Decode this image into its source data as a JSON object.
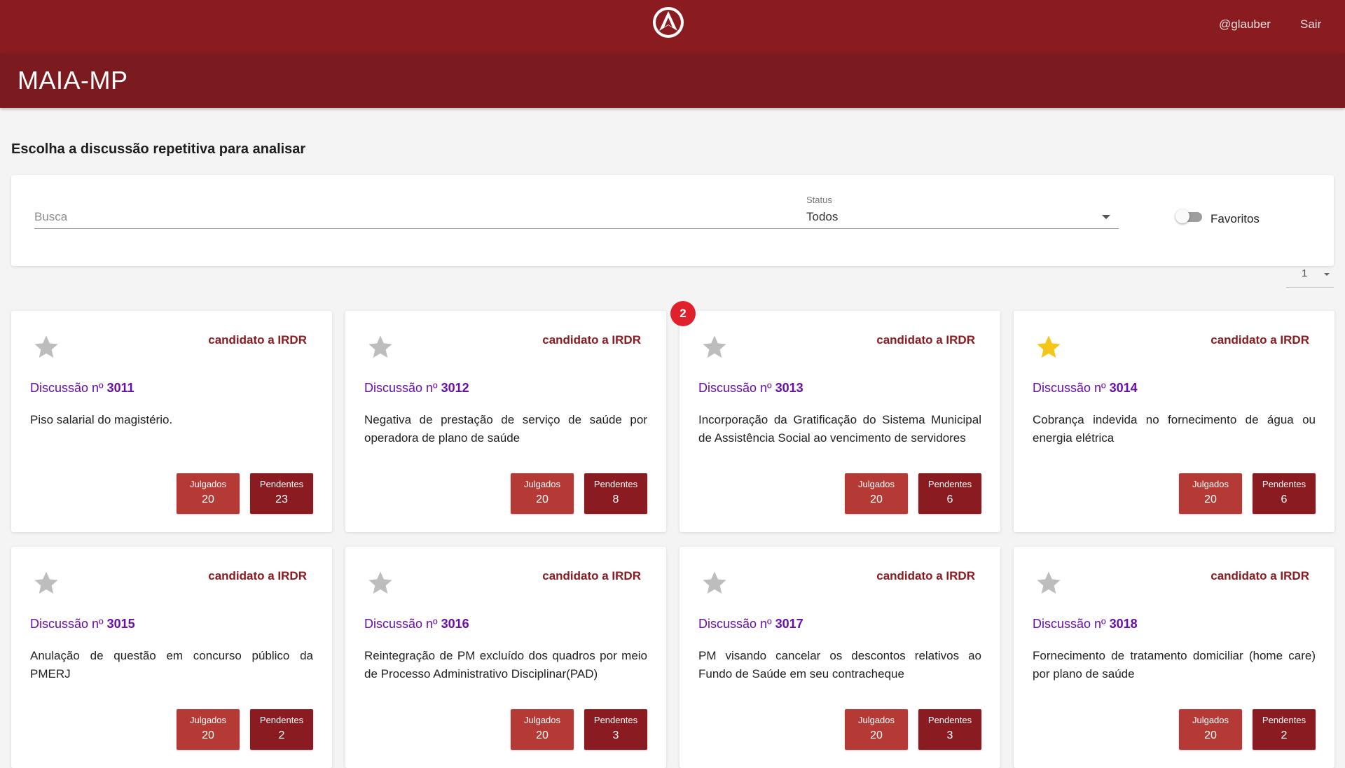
{
  "header": {
    "username": "@glauber",
    "logout_label": "Sair",
    "app_title": "MAIA-MP"
  },
  "page": {
    "heading": "Escolha a discussão repetitiva para analisar"
  },
  "filters": {
    "search_placeholder": "Busca",
    "status_label": "Status",
    "status_value": "Todos",
    "favorites_label": "Favoritos",
    "favorites_on": false
  },
  "pagination": {
    "page": "1"
  },
  "notification_count": "2",
  "colors": {
    "header_bg": "#8a1b20",
    "title_bg": "#7b1a1f",
    "discussion_link": "#6a0dad",
    "judged_btn": "#b53a36",
    "pending_btn": "#8a1b20",
    "favorite_star": "#f5c518",
    "badge": "#e0202a"
  },
  "cards": [
    {
      "tag": "candidato a IRDR",
      "prefix": "Discussão nº",
      "number": "3011",
      "description": "Piso salarial do magistério.",
      "favorite": false,
      "judged_label": "Julgados",
      "judged": "20",
      "pending_label": "Pendentes",
      "pending": "23"
    },
    {
      "tag": "candidato a IRDR",
      "prefix": "Discussão nº",
      "number": "3012",
      "description": "Negativa de prestação de serviço de saúde por operadora de plano de saúde",
      "favorite": false,
      "judged_label": "Julgados",
      "judged": "20",
      "pending_label": "Pendentes",
      "pending": "8"
    },
    {
      "tag": "candidato a IRDR",
      "prefix": "Discussão nº",
      "number": "3013",
      "description": "Incorporação da Gratificação do Sistema Municipal de Assistência Social ao vencimento de servidores",
      "favorite": false,
      "judged_label": "Julgados",
      "judged": "20",
      "pending_label": "Pendentes",
      "pending": "6"
    },
    {
      "tag": "candidato a IRDR",
      "prefix": "Discussão nº",
      "number": "3014",
      "description": "Cobrança indevida no fornecimento de água ou energia elétrica",
      "favorite": true,
      "judged_label": "Julgados",
      "judged": "20",
      "pending_label": "Pendentes",
      "pending": "6"
    },
    {
      "tag": "candidato a IRDR",
      "prefix": "Discussão nº",
      "number": "3015",
      "description": "Anulação de questão em concurso público da PMERJ",
      "favorite": false,
      "judged_label": "Julgados",
      "judged": "20",
      "pending_label": "Pendentes",
      "pending": "2"
    },
    {
      "tag": "candidato a IRDR",
      "prefix": "Discussão nº",
      "number": "3016",
      "description": "Reintegração de PM excluído dos quadros por meio de Processo Administrativo Disciplinar(PAD)",
      "favorite": false,
      "judged_label": "Julgados",
      "judged": "20",
      "pending_label": "Pendentes",
      "pending": "3"
    },
    {
      "tag": "candidato a IRDR",
      "prefix": "Discussão nº",
      "number": "3017",
      "description": "PM visando cancelar os descontos relativos ao Fundo de Saúde em seu contracheque",
      "favorite": false,
      "judged_label": "Julgados",
      "judged": "20",
      "pending_label": "Pendentes",
      "pending": "3"
    },
    {
      "tag": "candidato a IRDR",
      "prefix": "Discussão nº",
      "number": "3018",
      "description": "Fornecimento de tratamento domiciliar (home care) por plano de saúde",
      "favorite": false,
      "judged_label": "Julgados",
      "judged": "20",
      "pending_label": "Pendentes",
      "pending": "2"
    }
  ]
}
